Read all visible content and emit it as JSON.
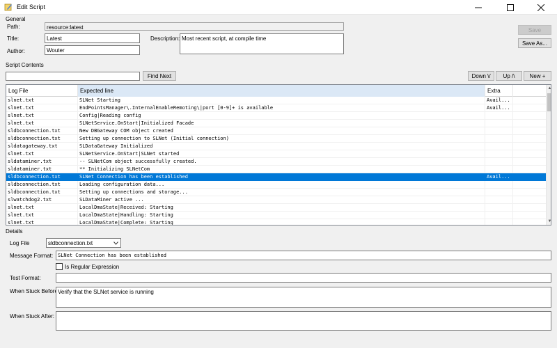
{
  "window": {
    "title": "Edit Script"
  },
  "general": {
    "group_label": "General",
    "path_label": "Path:",
    "path_value": "resource:latest",
    "title_label": "Title:",
    "title_value": "Latest",
    "author_label": "Author:",
    "author_value": "Wouter",
    "description_label": "Description:",
    "description_value": "Most recent script, at compile time",
    "save_label": "Save",
    "save_as_label": "Save As..."
  },
  "script_contents": {
    "group_label": "Script Contents",
    "search_value": "",
    "find_next_label": "Find Next",
    "down_label": "Down \\/",
    "up_label": "Up /\\",
    "new_label": "New +",
    "columns": [
      "Log File",
      "Expected line",
      "Extra",
      ""
    ],
    "rows": [
      {
        "log": "slnet.txt",
        "expected": "SLNet Starting",
        "extra": "Avail..."
      },
      {
        "log": "slnet.txt",
        "expected": "EndPointsManager\\.InternalEnableRemoting\\|port [0-9]+ is available",
        "extra": "Avail..."
      },
      {
        "log": "slnet.txt",
        "expected": "Config|Reading config",
        "extra": ""
      },
      {
        "log": "slnet.txt",
        "expected": "SLNetService.OnStart|Initialized Facade",
        "extra": ""
      },
      {
        "log": "sldbconnection.txt",
        "expected": "New DBGateway COM object created",
        "extra": ""
      },
      {
        "log": "sldbconnection.txt",
        "expected": "Setting up connection to SLNet (Initial connection)",
        "extra": ""
      },
      {
        "log": "sldatagateway.txt",
        "expected": "SLDataGateway Initialized",
        "extra": ""
      },
      {
        "log": "slnet.txt",
        "expected": "SLNetService.OnStart|SLNet started",
        "extra": ""
      },
      {
        "log": "sldataminer.txt",
        "expected": "-- SLNetCom object successfully created.",
        "extra": ""
      },
      {
        "log": "sldataminer.txt",
        "expected": "** Initializing SLNetCom",
        "extra": ""
      },
      {
        "log": "sldbconnection.txt",
        "expected": "SLNet Connection has been established",
        "extra": "Avail..."
      },
      {
        "log": "sldbconnection.txt",
        "expected": "Loading configuration data...",
        "extra": ""
      },
      {
        "log": "sldbconnection.txt",
        "expected": "Setting up connections and storage...",
        "extra": ""
      },
      {
        "log": "slwatchdog2.txt",
        "expected": "SLDataMiner active ...",
        "extra": ""
      },
      {
        "log": "slnet.txt",
        "expected": "LocalDmaState|Received: Starting",
        "extra": ""
      },
      {
        "log": "slnet.txt",
        "expected": "LocalDmaState|Handling: Starting",
        "extra": ""
      },
      {
        "log": "slnet.txt",
        "expected": "LocalDmaState|Complete: Starting",
        "extra": ""
      }
    ],
    "selected_row": 10
  },
  "details": {
    "group_label": "Details",
    "log_file_label": "Log File",
    "log_file_value": "sldbconnection.txt",
    "message_format_label": "Message Format:",
    "message_format_value": "SLNet Connection has been established",
    "regex_label": "Is Regular Expression",
    "test_format_label": "Test Format:",
    "test_format_value": "",
    "stuck_before_label": "When Stuck Before:",
    "stuck_before_value": "Verify that the SLNet service is running",
    "stuck_after_label": "When Stuck After:",
    "stuck_after_value": ""
  },
  "icons": [
    "app-icon",
    "minimize-icon",
    "maximize-icon",
    "close-icon",
    "dropdown-arrow-icon",
    "scroll-up-icon",
    "scroll-down-icon"
  ]
}
